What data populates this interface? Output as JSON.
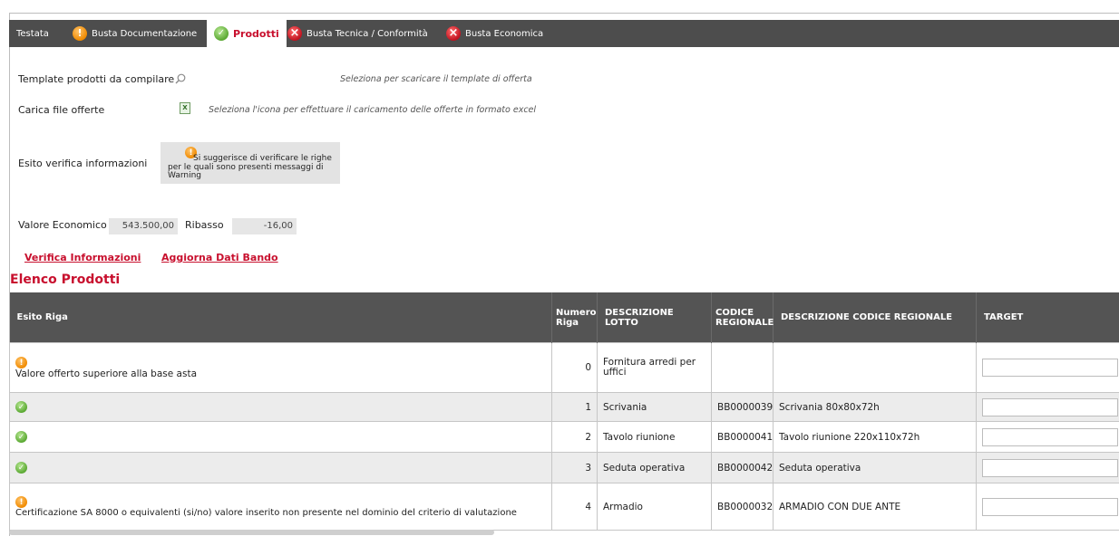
{
  "tabs": [
    {
      "label": "Testata",
      "status": "none"
    },
    {
      "label": "Busta Documentazione",
      "status": "warning"
    },
    {
      "label": "Prodotti",
      "status": "ok",
      "active": true
    },
    {
      "label": "Busta Tecnica / Conformità",
      "status": "error"
    },
    {
      "label": "Busta Economica",
      "status": "error"
    }
  ],
  "form": {
    "template_label": "Template prodotti da compilare",
    "template_hint": "Seleziona per scaricare il template di offerta",
    "upload_label": "Carica file offerte",
    "upload_hint": "Seleziona l'icona per effettuare il caricamento delle offerte in formato excel",
    "esito_label": "Esito verifica informazioni",
    "esito_message": "Si suggerisce di verificare le righe per le quali sono presenti messaggi di Warning",
    "valore_label": "Valore Economico",
    "valore_value": "543.500,00",
    "ribasso_label": "Ribasso",
    "ribasso_value": "-16,00"
  },
  "links": {
    "verifica": "Verifica Informazioni",
    "aggiorna": "Aggiorna Dati Bando"
  },
  "section_title": "Elenco Prodotti",
  "table": {
    "headers": {
      "esito": "Esito Riga",
      "numero": "Numero Riga",
      "descrizione_lotto": "DESCRIZIONE LOTTO",
      "codice": "CODICE REGIONALE",
      "descrizione_codice": "DESCRIZIONE CODICE REGIONALE",
      "target": "TARGET"
    },
    "rows": [
      {
        "status": "warning",
        "message": "Valore offerto superiore alla base asta",
        "numero": "0",
        "lotto": "Fornitura arredi per uffici",
        "codice": "",
        "descrizione": ""
      },
      {
        "status": "ok",
        "message": "",
        "numero": "1",
        "lotto": "Scrivania",
        "codice": "BB0000039",
        "descrizione": "Scrivania 80x80x72h"
      },
      {
        "status": "ok",
        "message": "",
        "numero": "2",
        "lotto": "Tavolo riunione",
        "codice": "BB0000041",
        "descrizione": "Tavolo riunione 220x110x72h"
      },
      {
        "status": "ok",
        "message": "",
        "numero": "3",
        "lotto": "Seduta operativa",
        "codice": "BB0000042",
        "descrizione": "Seduta operativa"
      },
      {
        "status": "warning",
        "message": "Certificazione SA 8000 o equivalenti (si/no) valore inserito non presente nel dominio del criterio di valutazione",
        "numero": "4",
        "lotto": "Armadio",
        "codice": "BB0000032",
        "descrizione": "ARMADIO CON DUE ANTE"
      }
    ]
  }
}
